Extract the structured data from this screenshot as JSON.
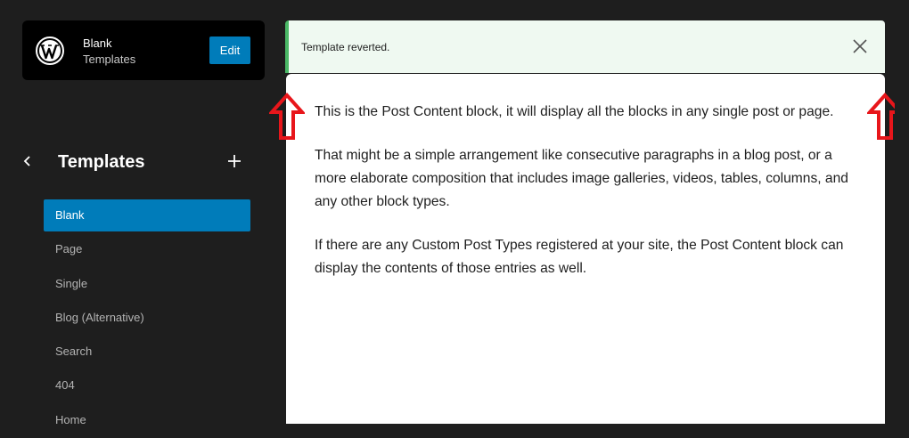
{
  "site": {
    "title": "Blank",
    "subtitle": "Templates",
    "edit_label": "Edit",
    "logo_icon": "wordpress-logo-icon"
  },
  "nav": {
    "title": "Templates",
    "back_icon": "chevron-left-icon",
    "add_icon": "plus-icon",
    "items": [
      {
        "label": "Blank",
        "active": true
      },
      {
        "label": "Page",
        "active": false
      },
      {
        "label": "Single",
        "active": false
      },
      {
        "label": "Blog (Alternative)",
        "active": false
      },
      {
        "label": "Search",
        "active": false
      },
      {
        "label": "404",
        "active": false
      },
      {
        "label": "Home",
        "active": false
      }
    ]
  },
  "notice": {
    "text": "Template reverted.",
    "close_icon": "close-icon"
  },
  "content": {
    "paragraphs": [
      "This is the Post Content block, it will display all the blocks in any single post or page.",
      "That might be a simple arrangement like consecutive paragraphs in a blog post, or a more elaborate composition that includes image galleries, videos, tables, columns, and any other block types.",
      "If there are any Custom Post Types registered at your site, the Post Content block can display the contents of those entries as well."
    ]
  },
  "annotation": {
    "arrow_icon": "up-arrow-icon",
    "color": "#e8161b"
  },
  "colors": {
    "accent": "#007cba",
    "success_border": "#4ab866",
    "notice_bg": "#eff9f1"
  }
}
